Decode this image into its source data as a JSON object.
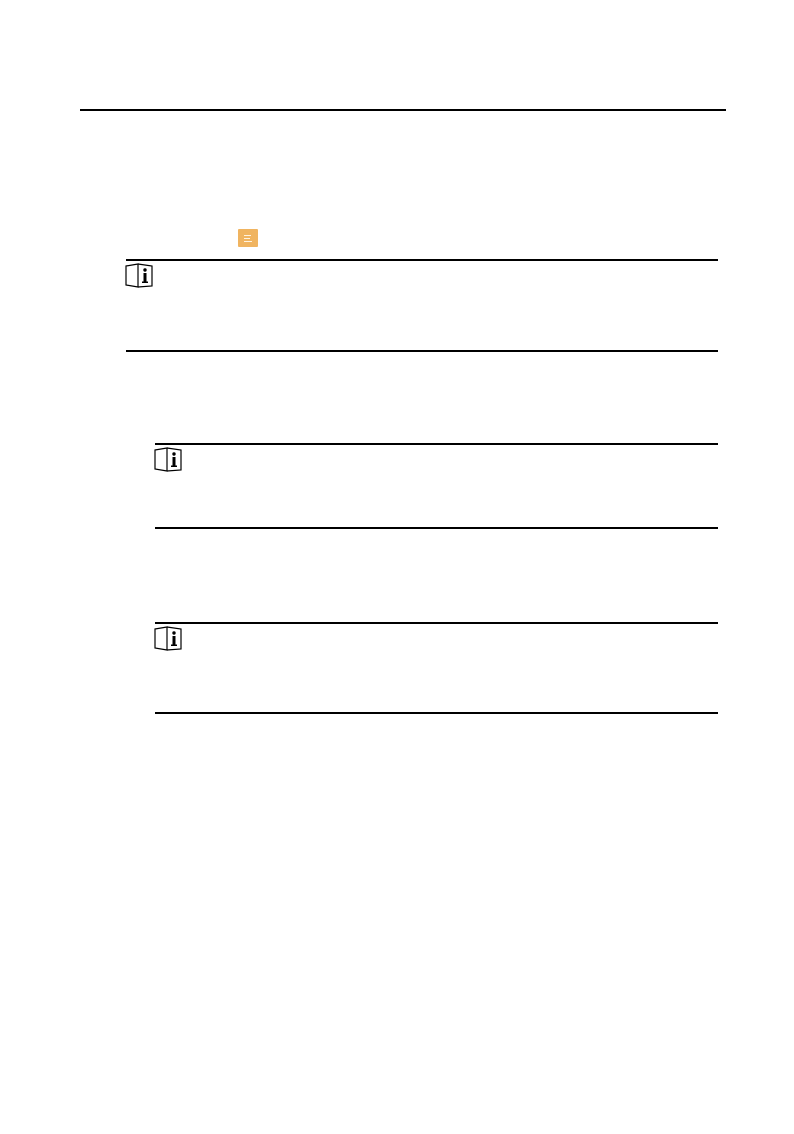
{
  "page": {
    "header_rule": true,
    "menu_button": {
      "icon": "menu-lines-icon",
      "color": "#F0B460"
    },
    "notes": [
      {
        "icon": "book-info-icon"
      },
      {
        "icon": "book-info-icon"
      },
      {
        "icon": "book-info-icon"
      }
    ]
  }
}
